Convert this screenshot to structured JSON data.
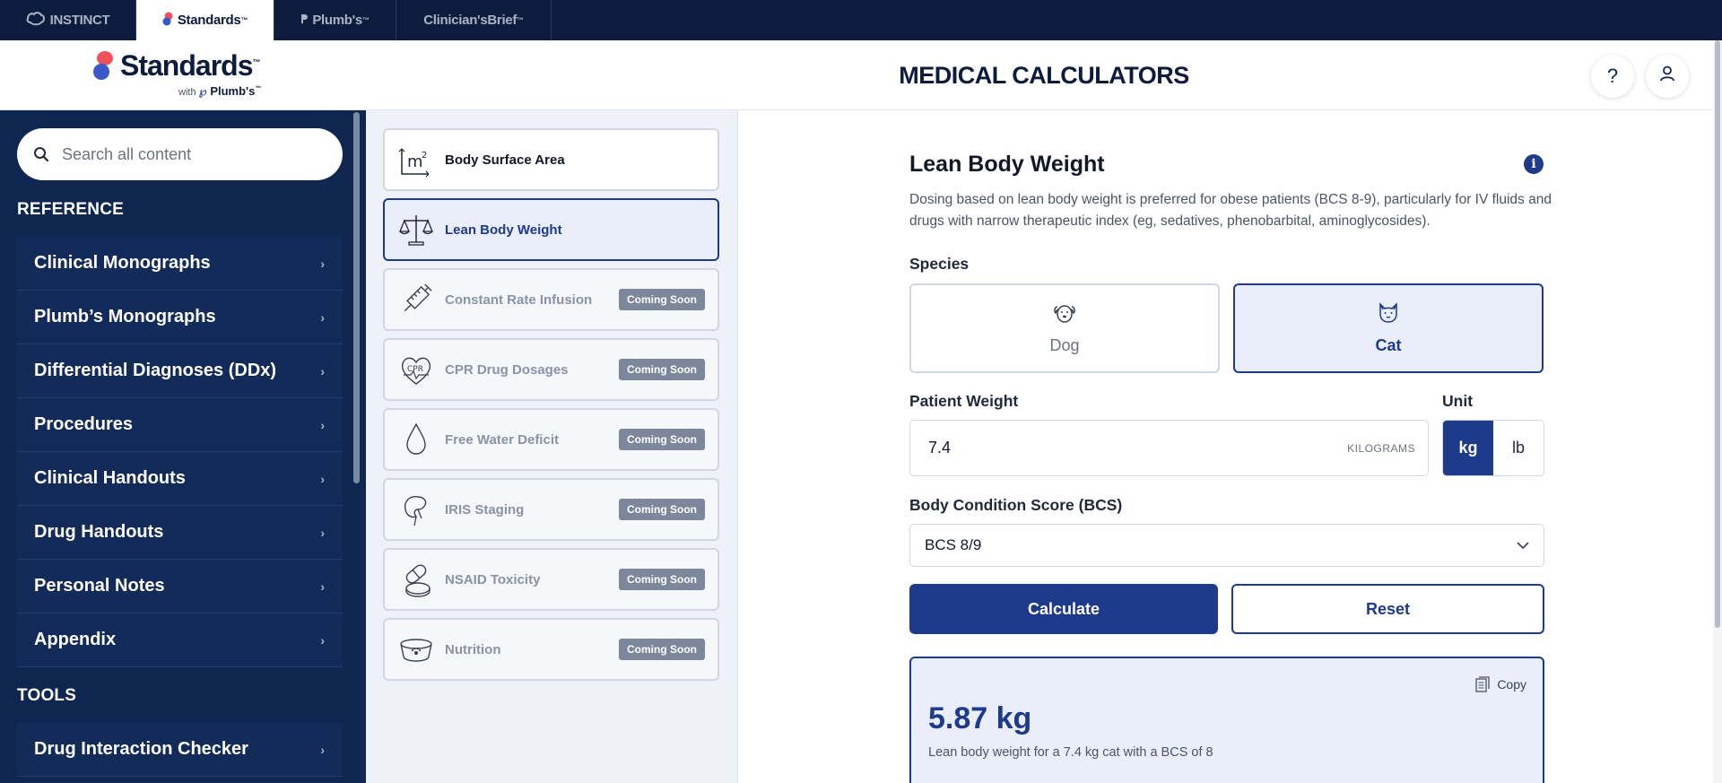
{
  "top_tabs": [
    {
      "label": "INSTINCT"
    },
    {
      "label": "Standards",
      "tm": "™"
    },
    {
      "label": "Plumb's",
      "tm": "™"
    },
    {
      "label": "Clinician'sBrief",
      "tm": "™"
    }
  ],
  "logo": {
    "name": "Standards",
    "tm": "™",
    "with": "with",
    "partner": "Plumb's",
    "partner_tm": "™"
  },
  "search": {
    "placeholder": "Search all content"
  },
  "sidebar": {
    "reference_heading": "REFERENCE",
    "reference_items": [
      {
        "label": "Clinical Monographs"
      },
      {
        "label": "Plumb’s Monographs"
      },
      {
        "label": "Differential Diagnoses (DDx)"
      },
      {
        "label": "Procedures"
      },
      {
        "label": "Clinical Handouts"
      },
      {
        "label": "Drug Handouts"
      },
      {
        "label": "Personal Notes"
      },
      {
        "label": "Appendix"
      }
    ],
    "tools_heading": "TOOLS",
    "tools_items": [
      {
        "label": "Drug Interaction Checker"
      }
    ]
  },
  "header": {
    "title": "MEDICAL CALCULATORS",
    "help_icon": "question-icon",
    "user_icon": "user-icon"
  },
  "calculators": [
    {
      "label": "Body Surface Area",
      "icon": "m2-icon",
      "icon_text": "m",
      "icon_sup": "2",
      "status": "available"
    },
    {
      "label": "Lean Body Weight",
      "icon": "scale-icon",
      "status": "selected"
    },
    {
      "label": "Constant Rate Infusion",
      "icon": "syringe-icon",
      "badge": "Coming Soon"
    },
    {
      "label": "CPR Drug Dosages",
      "icon": "cpr-heart-icon",
      "icon_text": "CPR",
      "badge": "Coming Soon"
    },
    {
      "label": "Free Water Deficit",
      "icon": "water-drop-icon",
      "badge": "Coming Soon"
    },
    {
      "label": "IRIS Staging",
      "icon": "kidney-icon",
      "badge": "Coming Soon"
    },
    {
      "label": "NSAID Toxicity",
      "icon": "pills-icon",
      "badge": "Coming Soon"
    },
    {
      "label": "Nutrition",
      "icon": "pet-bowl-icon",
      "badge": "Coming Soon"
    }
  ],
  "calculator": {
    "title": "Lean Body Weight",
    "description": "Dosing based on lean body weight is preferred for obese patients (BCS 8-9), particularly for IV fluids and drugs with narrow therapeutic index (eg, sedatives, phenobarbital, aminoglycosides).",
    "species_label": "Species",
    "species": [
      {
        "label": "Dog",
        "selected": false
      },
      {
        "label": "Cat",
        "selected": true
      }
    ],
    "weight_label": "Patient Weight",
    "weight_value": "7.4",
    "weight_unit_text": "KILOGRAMS",
    "unit_label": "Unit",
    "units": [
      {
        "label": "kg",
        "selected": true
      },
      {
        "label": "lb",
        "selected": false
      }
    ],
    "bcs_label": "Body Condition Score (BCS)",
    "bcs_value": "BCS 8/9",
    "calculate_label": "Calculate",
    "reset_label": "Reset",
    "result": {
      "copy_label": "Copy",
      "value": "5.87 kg",
      "note": "Lean body weight for a 7.4 kg cat with a BCS of 8"
    }
  },
  "colors": {
    "navy": "#0d1c3d",
    "primary": "#1e3a8a",
    "sidebar": "#0f2650",
    "selected_bg": "#e9eefa",
    "badge": "#7c879b"
  }
}
